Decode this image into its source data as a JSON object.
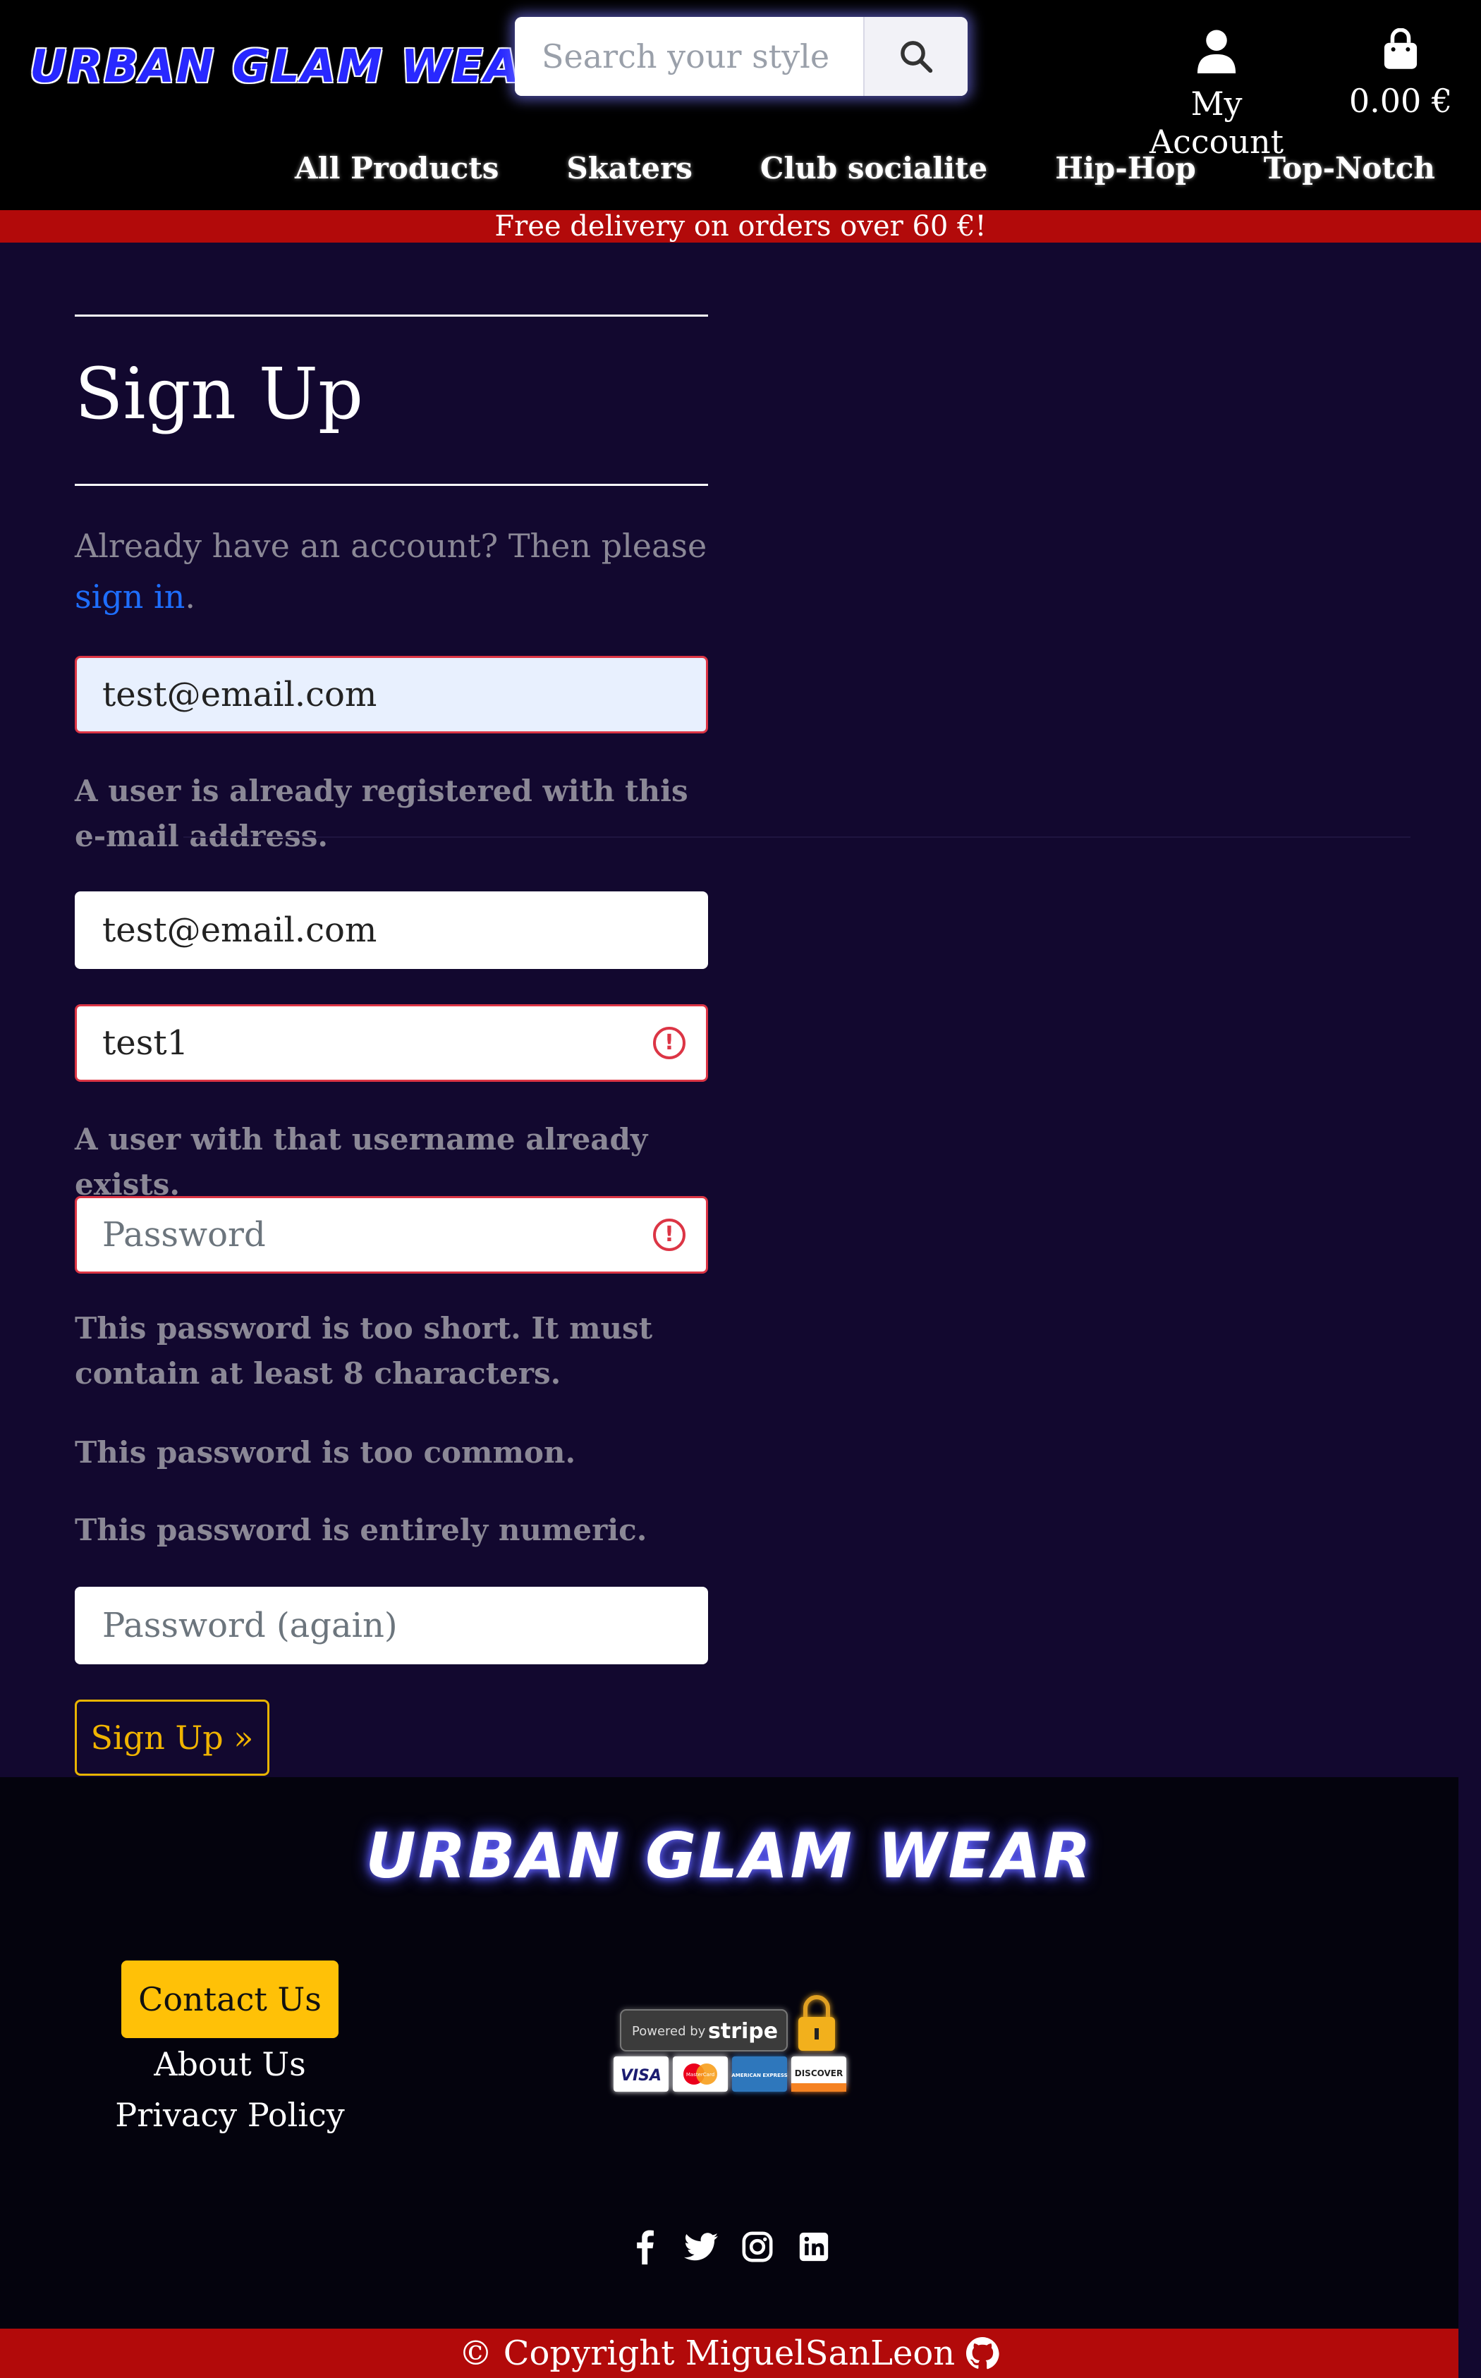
{
  "header": {
    "logo": "URBAN GLAM WEAR",
    "search_placeholder": "Search your style",
    "account_label": "My Account",
    "cart_total": "0.00 €"
  },
  "nav": {
    "items": [
      "All Products",
      "Skaters",
      "Club socialite",
      "Hip-Hop",
      "Top-Notch"
    ]
  },
  "banner": "Free delivery on orders over 60 €!",
  "form": {
    "title": "Sign Up",
    "already_text": "Already have an account? Then please",
    "sign_in_link": "sign in",
    "period": ".",
    "email_value": "test@email.com",
    "email_error": "A user is already registered with this e-mail address.",
    "email_confirm_value": "test@email.com",
    "username_value": "test1",
    "username_error": "A user with that username already exists.",
    "password_placeholder": "Password",
    "password_errors": [
      "This password is too short. It must contain at least 8 characters.",
      "This password is too common.",
      "This password is entirely numeric."
    ],
    "password_again_placeholder": "Password (again)",
    "submit_label": "Sign Up »"
  },
  "footer": {
    "logo": "URBAN GLAM WEAR",
    "contact_label": "Contact Us",
    "about_label": "About Us",
    "privacy_label": "Privacy Policy",
    "stripe": {
      "powered_by": "Powered by",
      "brand": "stripe",
      "cards": [
        "VISA",
        "MasterCard",
        "AMERICAN EXPRESS",
        "DISCOVER"
      ]
    },
    "socials": [
      "facebook-icon",
      "twitter-icon",
      "instagram-icon",
      "linkedin-icon"
    ],
    "copyright": "© Copyright MiguelSanLeon"
  },
  "colors": {
    "background": "#12082f",
    "header": "#000000",
    "banner": "#b20a0a",
    "link": "#1e6eff",
    "error": "#dc3545",
    "accent": "#ffc107"
  }
}
